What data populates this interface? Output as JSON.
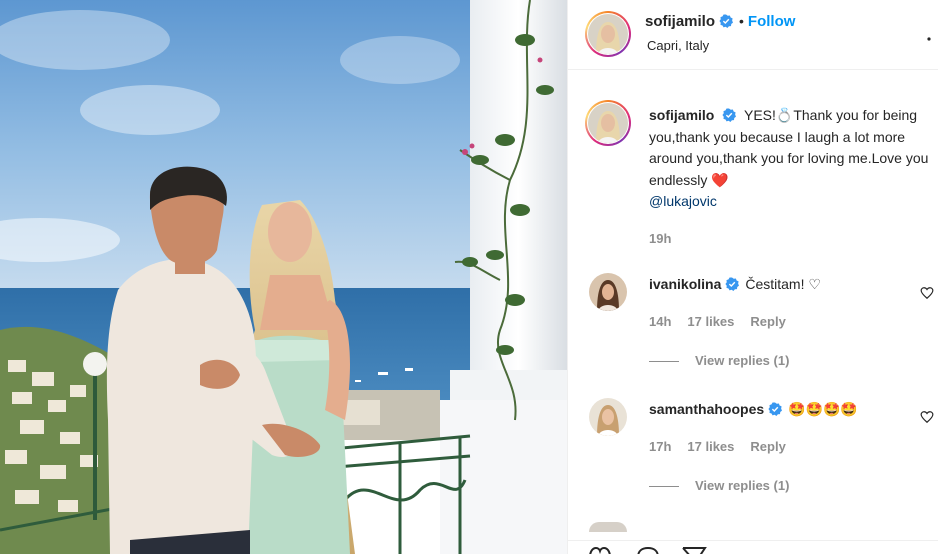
{
  "post": {
    "author": "sofijamilo",
    "follow_label": "Follow",
    "follow_separator": "•",
    "location": "Capri, Italy",
    "more_label": "..."
  },
  "caption": {
    "username": "sofijamilo",
    "text_before_emoji": "YES!",
    "emoji_ring": "💍",
    "text": "Thank you for being you,thank you because I laugh a lot more around you,thank you for loving me.Love you endlessly",
    "emoji_heart": "❤️",
    "mention": "@lukajovic",
    "time": "19h"
  },
  "comments": [
    {
      "username": "ivanikolina",
      "text": "Čestitam! ♡",
      "time": "14h",
      "likes": "17 likes",
      "reply_label": "Reply",
      "view_replies": "View replies (1)"
    },
    {
      "username": "samanthahoopes",
      "text": "🤩🤩🤩🤩",
      "time": "17h",
      "likes": "17 likes",
      "reply_label": "Reply",
      "view_replies": "View replies (1)"
    }
  ],
  "colors": {
    "accent": "#0095f6",
    "verified": "#3897f0",
    "muted": "#8e8e8e",
    "mention": "#00376b"
  },
  "icons": {
    "verified": "verified-badge-icon",
    "heart": "heart-outline-icon",
    "like": "like-heart-icon",
    "comment": "comment-icon",
    "share": "share-icon",
    "more": "more-options-icon"
  }
}
